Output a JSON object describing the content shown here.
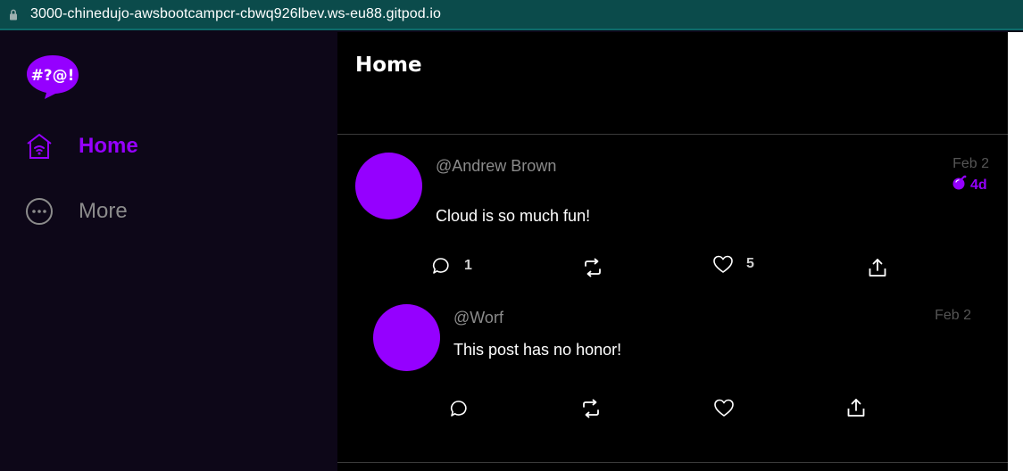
{
  "browser": {
    "url": "3000-chinedujo-awsbootcampcr-cbwq926lbev.ws-eu88.gitpod.io"
  },
  "sidebar": {
    "logo_text": "#?@!",
    "items": [
      {
        "label": "Home",
        "icon": "home-icon",
        "active": true
      },
      {
        "label": "More",
        "icon": "more-icon",
        "active": false
      }
    ]
  },
  "main": {
    "title": "Home",
    "activities": [
      {
        "handle": "@Andrew Brown",
        "date": "Feb 2",
        "expires": "4d",
        "message": "Cloud is so much fun!",
        "replies_count": "1",
        "reposts_count": "",
        "likes_count": "5"
      },
      {
        "handle": "@Worf",
        "date": "Feb 2",
        "message": "This post has no honor!",
        "replies_count": "",
        "reposts_count": "",
        "likes_count": ""
      }
    ]
  },
  "colors": {
    "accent": "#9500ff",
    "sidebar_bg": "#0d0718",
    "main_bg": "#000000",
    "urlbar_bg": "#0b4b4b"
  }
}
